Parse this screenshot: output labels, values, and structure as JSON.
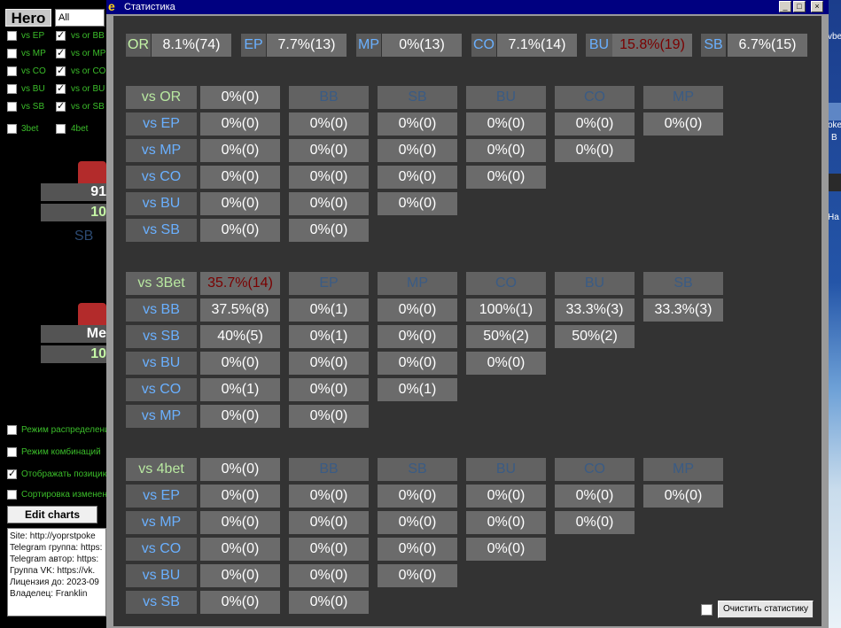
{
  "background_app": {
    "hero_label": "Hero",
    "filter_value": "All",
    "left_checks": [
      "vs EP",
      "vs MP",
      "vs CO",
      "vs BU",
      "vs SB",
      "3bet"
    ],
    "right_checks": [
      "vs or BB",
      "vs or MP",
      "vs or CO",
      "vs or BU",
      "vs or SB",
      "4bet"
    ],
    "upper_value_1": "91",
    "upper_value_2": "10",
    "upper_position": "SB",
    "lower_value_1": "Me",
    "lower_value_2": "10",
    "options": [
      "Режим распределения",
      "Режим комбинаций",
      "Отображать позицию",
      "Сортировка изменения"
    ],
    "edit_charts": "Edit charts",
    "info_lines": [
      "Site: http://yoprstpoke",
      "Telegram группа: https:",
      "Telegram автор: https:",
      "Группа VK: https://vk.",
      "Лицензия до: 2023-09",
      "Владелец: Franklin"
    ]
  },
  "desktop": {
    "icon_labels": [
      "vbe",
      "oke",
      "B",
      "На"
    ]
  },
  "window": {
    "title": "Статистика",
    "controls": {
      "minimize": "_",
      "maximize": "□",
      "close": "×"
    },
    "top_stats": [
      {
        "label": "OR",
        "value": "8.1%(74)",
        "label_color": "green"
      },
      {
        "label": "EP",
        "value": "7.7%(13)"
      },
      {
        "label": "MP",
        "value": "0%(13)"
      },
      {
        "label": "CO",
        "value": "7.1%(14)"
      },
      {
        "label": "BU",
        "value": "15.8%(19)",
        "value_color": "red"
      },
      {
        "label": "SB",
        "value": "6.7%(15)"
      }
    ],
    "sections": [
      {
        "header": "vs OR",
        "header_value": "0%(0)",
        "header_value_red": false,
        "columns": [
          "BB",
          "SB",
          "BU",
          "CO",
          "MP"
        ],
        "rows": [
          {
            "label": "vs EP",
            "values": [
              "0%(0)",
              "0%(0)",
              "0%(0)",
              "0%(0)",
              "0%(0)",
              "0%(0)"
            ]
          },
          {
            "label": "vs MP",
            "values": [
              "0%(0)",
              "0%(0)",
              "0%(0)",
              "0%(0)",
              "0%(0)"
            ]
          },
          {
            "label": "vs CO",
            "values": [
              "0%(0)",
              "0%(0)",
              "0%(0)",
              "0%(0)"
            ]
          },
          {
            "label": "vs BU",
            "values": [
              "0%(0)",
              "0%(0)",
              "0%(0)"
            ]
          },
          {
            "label": "vs SB",
            "values": [
              "0%(0)",
              "0%(0)"
            ]
          }
        ]
      },
      {
        "header": "vs 3Bet",
        "header_value": "35.7%(14)",
        "header_value_red": true,
        "columns": [
          "EP",
          "MP",
          "CO",
          "BU",
          "SB"
        ],
        "rows": [
          {
            "label": "vs BB",
            "values": [
              "37.5%(8)",
              "0%(1)",
              "0%(0)",
              "100%(1)",
              "33.3%(3)",
              "33.3%(3)"
            ]
          },
          {
            "label": "vs SB",
            "values": [
              "40%(5)",
              "0%(1)",
              "0%(0)",
              "50%(2)",
              "50%(2)"
            ]
          },
          {
            "label": "vs BU",
            "values": [
              "0%(0)",
              "0%(0)",
              "0%(0)",
              "0%(0)"
            ]
          },
          {
            "label": "vs CO",
            "values": [
              "0%(1)",
              "0%(0)",
              "0%(1)"
            ]
          },
          {
            "label": "vs MP",
            "values": [
              "0%(0)",
              "0%(0)"
            ]
          }
        ]
      },
      {
        "header": "vs 4bet",
        "header_value": "0%(0)",
        "header_value_red": false,
        "columns": [
          "BB",
          "SB",
          "BU",
          "CO",
          "MP"
        ],
        "rows": [
          {
            "label": "vs EP",
            "values": [
              "0%(0)",
              "0%(0)",
              "0%(0)",
              "0%(0)",
              "0%(0)",
              "0%(0)"
            ]
          },
          {
            "label": "vs MP",
            "values": [
              "0%(0)",
              "0%(0)",
              "0%(0)",
              "0%(0)",
              "0%(0)"
            ]
          },
          {
            "label": "vs CO",
            "values": [
              "0%(0)",
              "0%(0)",
              "0%(0)",
              "0%(0)"
            ]
          },
          {
            "label": "vs BU",
            "values": [
              "0%(0)",
              "0%(0)",
              "0%(0)"
            ]
          },
          {
            "label": "vs SB",
            "values": [
              "0%(0)",
              "0%(0)"
            ]
          }
        ]
      }
    ],
    "clear_checkbox_checked": false,
    "clear_button": "Очистить статистику"
  },
  "colors": {
    "panel_bg": "#333333",
    "accent_green": "#c3f3a6",
    "accent_blue": "#6ab0ff",
    "accent_red": "#7a0000"
  }
}
